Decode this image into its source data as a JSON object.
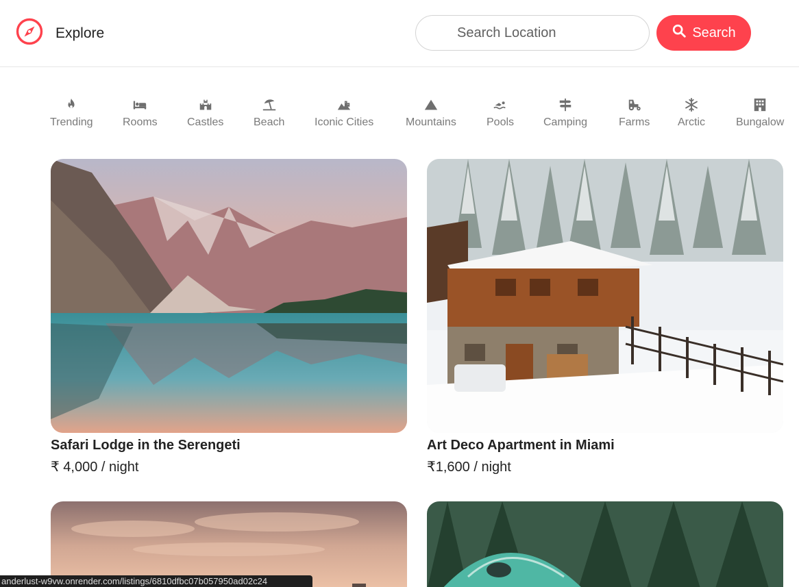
{
  "header": {
    "brand": "Explore",
    "search_placeholder": "Search Location",
    "search_button": "Search",
    "accent_color": "#fe424d"
  },
  "filters": [
    {
      "label": "Trending",
      "icon": "fire-icon"
    },
    {
      "label": "Rooms",
      "icon": "bed-icon"
    },
    {
      "label": "Castles",
      "icon": "castle-icon"
    },
    {
      "label": "Beach",
      "icon": "umbrella-beach-icon"
    },
    {
      "label": "Iconic Cities",
      "icon": "city-icon"
    },
    {
      "label": "Mountains",
      "icon": "mountain-icon"
    },
    {
      "label": "Pools",
      "icon": "swimmer-icon"
    },
    {
      "label": "Camping",
      "icon": "signpost-icon"
    },
    {
      "label": "Farms",
      "icon": "tractor-icon"
    },
    {
      "label": "Arctic",
      "icon": "snowflake-icon"
    },
    {
      "label": "Bungalow",
      "icon": "building-icon"
    }
  ],
  "listings": [
    {
      "title": "Safari Lodge in the Serengeti",
      "price": "₹ 4,000 / night",
      "image": "mountain-lake"
    },
    {
      "title": "Art Deco Apartment in Miami",
      "price": "₹1,600 / night",
      "image": "snowy-chalet"
    },
    {
      "image": "sunset-sky"
    },
    {
      "image": "forest-dome-tent"
    }
  ],
  "status_url": "anderlust-w9vw.onrender.com/listings/6810dfbc07b057950ad02c24"
}
